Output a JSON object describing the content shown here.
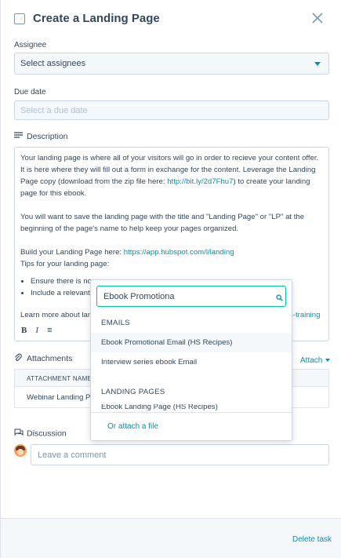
{
  "header": {
    "title": "Create a Landing Page"
  },
  "assignee": {
    "label": "Assignee",
    "value": "Select assignees"
  },
  "due_date": {
    "label": "Due date",
    "placeholder": "Select a due date"
  },
  "description": {
    "label": "Description",
    "p1_text": "Your landing page is where all of your visitors will go in order to recieve your content offer. It is here where they will fill out a form in exchange for the content. Leverage the Landing Page copy (download from the zip file here: ",
    "p1_link": "http://bit.ly/2d7Fhu7",
    "p1_tail": ") to create your landing page for this ebook.",
    "p2": "You will want to save the landing page with the title and  \"Landing Page\" or \"LP\" at the beginning of the page's name to help keep your pages organized.",
    "p3_text": "Build your Landing Page here: ",
    "p3_link": "https://app.hubspot.com/l/landing",
    "p4": "Tips for your landing page:",
    "bullet1": "Ensure there is no r",
    "bullet2": "Include a relevant i",
    "learn_more": "Learn more about land",
    "learn_more_link_tail": "s-training",
    "toolbar": {
      "bold": "B",
      "italic": "I",
      "list": "≡"
    }
  },
  "attachments": {
    "label": "Attachments",
    "attach_label": "Attach",
    "column_header": "ATTACHMENT NAME",
    "rows": [
      "Webinar Landing Pa"
    ]
  },
  "discussion": {
    "label": "Discussion",
    "comment_placeholder": "Leave a comment"
  },
  "footer": {
    "delete_label": "Delete task"
  },
  "dropdown": {
    "search_value": "Ebook Promotiona",
    "group_emails": "EMAILS",
    "emails": [
      "Ebook Promotional Email (HS Recipes)",
      "Interview series ebook Email"
    ],
    "group_landing": "LANDING PAGES",
    "landing_partial": "Ebook Landing Page (HS Recipes)",
    "attach_file": "Or attach a file"
  },
  "colors": {
    "accent": "#0091ae",
    "text": "#33475b",
    "search_border": "#00bda5",
    "input_bg": "#f5f8fa"
  }
}
